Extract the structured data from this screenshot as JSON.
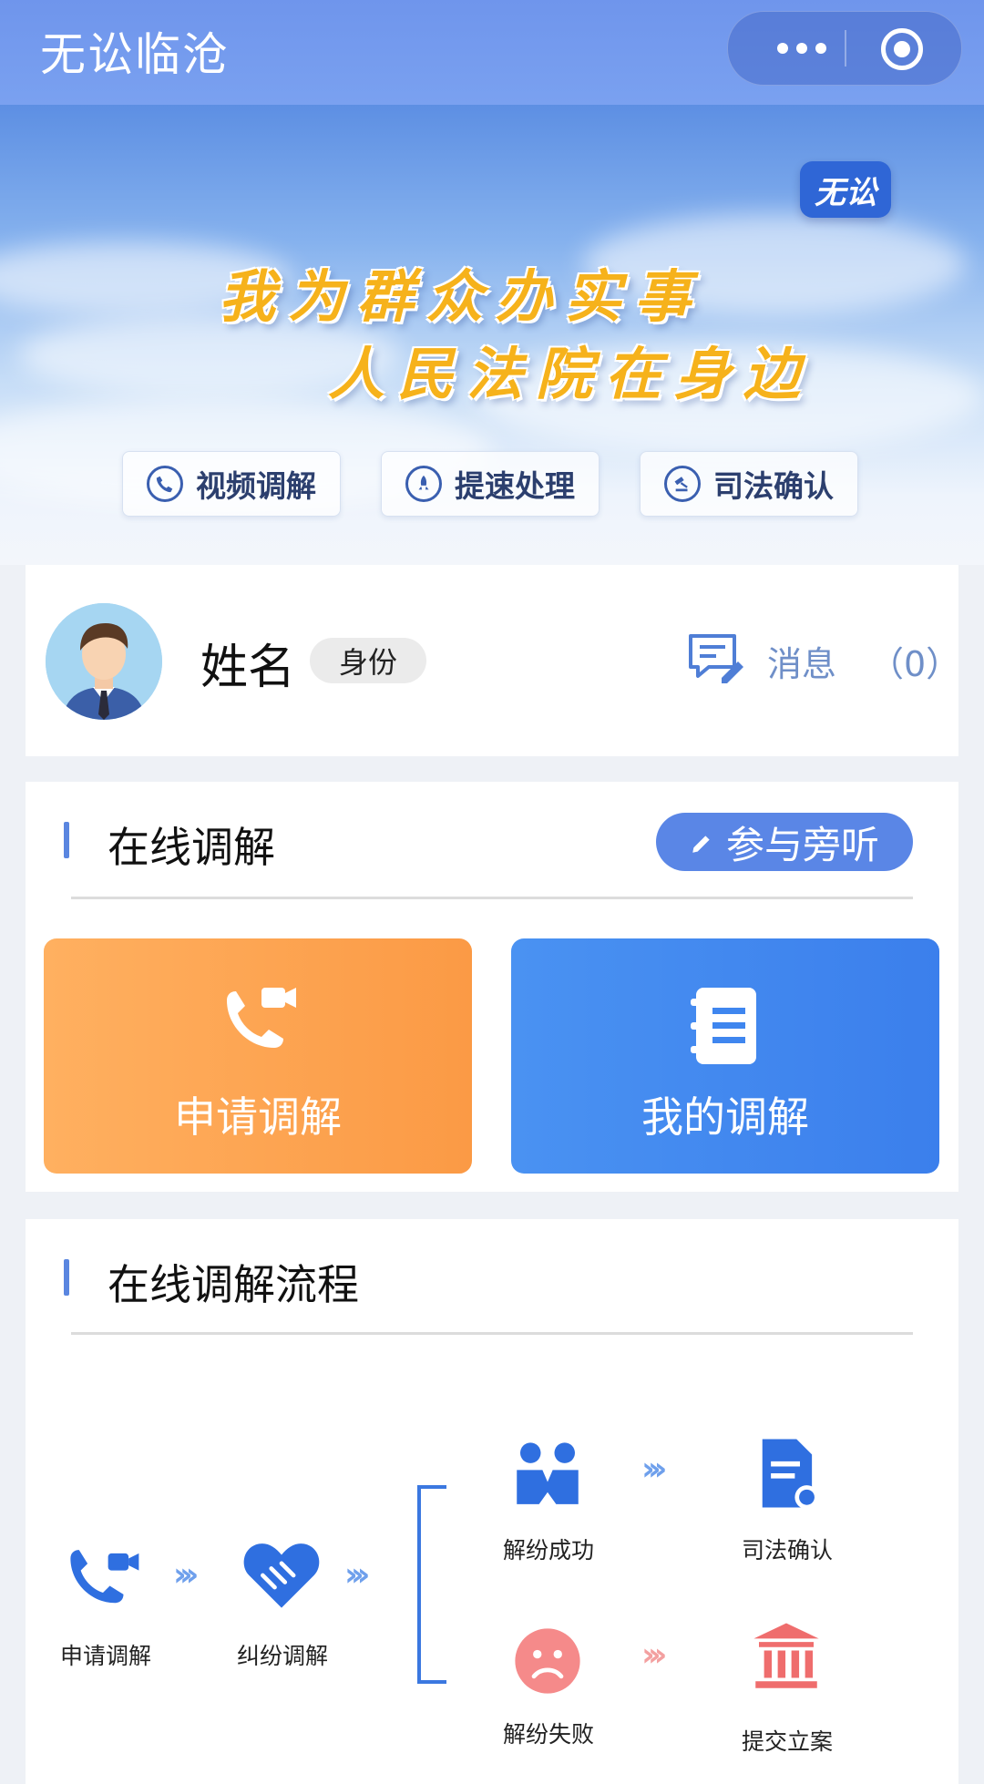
{
  "topbar": {
    "title": "无讼临沧"
  },
  "banner": {
    "logo_text": "无讼",
    "slogan_line1": "我为群众办实事",
    "slogan_line2": "人民法院在身边",
    "chips": [
      {
        "label": "视频调解",
        "icon": "video-call-icon"
      },
      {
        "label": "提速处理",
        "icon": "rocket-icon"
      },
      {
        "label": "司法确认",
        "icon": "gavel-icon"
      }
    ]
  },
  "profile": {
    "name": "姓名",
    "identity": "身份",
    "message_label": "消息",
    "message_count": "（0）"
  },
  "online_mediation": {
    "title": "在线调解",
    "attend_label": "参与旁听",
    "apply_label": "申请调解",
    "mine_label": "我的调解"
  },
  "flow": {
    "title": "在线调解流程",
    "steps": {
      "apply": "申请调解",
      "dispute": "纠纷调解",
      "success": "解纷成功",
      "confirm": "司法确认",
      "fail": "解纷失败",
      "file": "提交立案"
    }
  },
  "colors": {
    "accent": "#5a86e6",
    "orange": "#fb9a45",
    "blue": "#3b7fec",
    "slogan": "#f6b21b"
  }
}
